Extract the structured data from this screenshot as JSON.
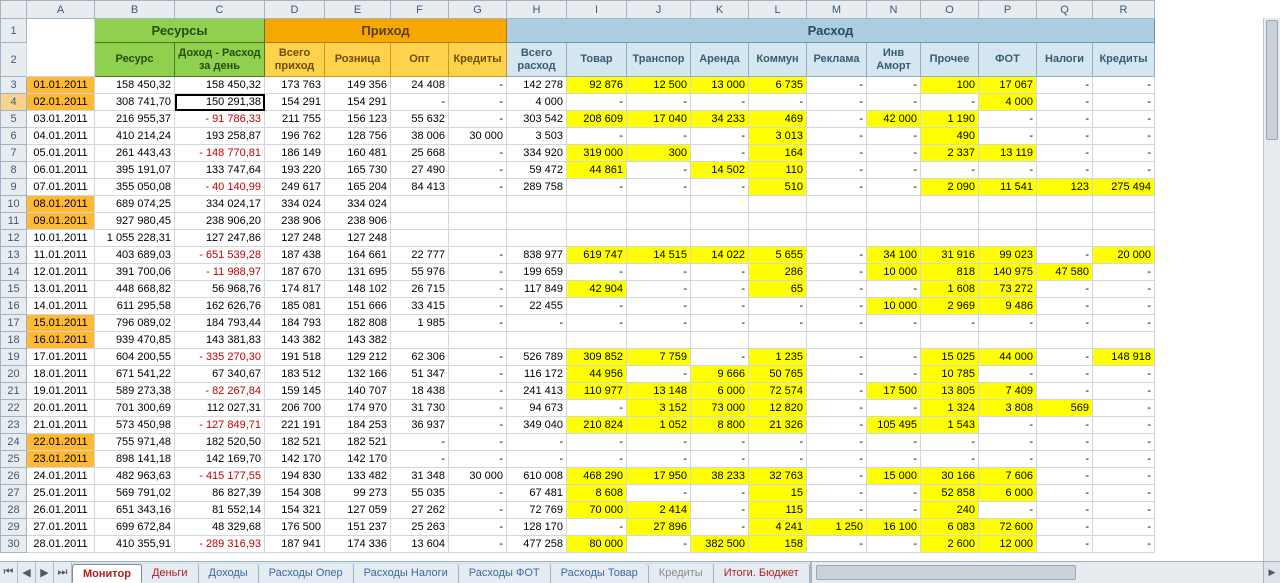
{
  "colLetters": [
    "A",
    "B",
    "C",
    "D",
    "E",
    "F",
    "G",
    "H",
    "I",
    "J",
    "K",
    "L",
    "M",
    "N",
    "O",
    "P",
    "Q",
    "R"
  ],
  "groups": {
    "res": "Ресурсы",
    "inc": "Приход",
    "exp": "Расход"
  },
  "sub": {
    "B": "Ресурс",
    "C": "Доход - Расход за день",
    "D": "Всего приход",
    "E": "Розница",
    "F": "Опт",
    "G": "Кредиты",
    "H": "Всего расход",
    "I": "Товар",
    "J": "Транспор",
    "K": "Аренда",
    "L": "Коммун",
    "M": "Реклама",
    "N": "Инв Аморт",
    "O": "Прочее",
    "P": "ФОТ",
    "Q": "Налоги",
    "R": "Кредиты"
  },
  "selectedCell": {
    "row": 4,
    "col": "C"
  },
  "rows": [
    {
      "n": 3,
      "A": "01.01.2011",
      "dOrange": true,
      "B": "158 450,32",
      "C": "158 450,32",
      "D": "173 763",
      "E": "149 356",
      "F": "24 408",
      "G": "-",
      "H": "142 278",
      "I": "92 876",
      "Iy": true,
      "J": "12 500",
      "Jy": true,
      "K": "13 000",
      "Ky": true,
      "L": "6 735",
      "Ly": true,
      "M": "-",
      "N": "-",
      "O": "100",
      "Oy": true,
      "P": "17 067",
      "Py": true,
      "Q": "-",
      "R": "-"
    },
    {
      "n": 4,
      "A": "02.01.2011",
      "dOrange": true,
      "B": "308 741,70",
      "C": "150 291,38",
      "D": "154 291",
      "E": "154 291",
      "F": "-",
      "G": "-",
      "H": "4 000",
      "I": "-",
      "J": "-",
      "K": "-",
      "L": "-",
      "M": "-",
      "N": "-",
      "O": "-",
      "P": "4 000",
      "Py": true,
      "Q": "-",
      "R": "-"
    },
    {
      "n": 5,
      "A": "03.01.2011",
      "B": "216 955,37",
      "C": "91 786,33",
      "Cred": true,
      "D": "211 755",
      "E": "156 123",
      "F": "55 632",
      "G": "-",
      "H": "303 542",
      "I": "208 609",
      "Iy": true,
      "J": "17 040",
      "Jy": true,
      "K": "34 233",
      "Ky": true,
      "L": "469",
      "Ly": true,
      "M": "-",
      "N": "42 000",
      "Ny": true,
      "O": "1 190",
      "Oy": true,
      "P": "-",
      "Q": "-",
      "R": "-"
    },
    {
      "n": 6,
      "A": "04.01.2011",
      "B": "410 214,24",
      "C": "193 258,87",
      "D": "196 762",
      "E": "128 756",
      "F": "38 006",
      "G": "30 000",
      "H": "3 503",
      "I": "-",
      "J": "-",
      "K": "-",
      "L": "3 013",
      "Ly": true,
      "M": "-",
      "N": "-",
      "O": "490",
      "Oy": true,
      "P": "-",
      "Q": "-",
      "R": "-"
    },
    {
      "n": 7,
      "A": "05.01.2011",
      "B": "261 443,43",
      "C": "148 770,81",
      "Cred": true,
      "D": "186 149",
      "E": "160 481",
      "F": "25 668",
      "G": "-",
      "H": "334 920",
      "I": "319 000",
      "Iy": true,
      "J": "300",
      "Jy": true,
      "K": "-",
      "L": "164",
      "Ly": true,
      "M": "-",
      "N": "-",
      "O": "2 337",
      "Oy": true,
      "P": "13 119",
      "Py": true,
      "Q": "-",
      "R": "-"
    },
    {
      "n": 8,
      "A": "06.01.2011",
      "B": "395 191,07",
      "C": "133 747,64",
      "D": "193 220",
      "E": "165 730",
      "F": "27 490",
      "G": "-",
      "H": "59 472",
      "I": "44 861",
      "Iy": true,
      "J": "-",
      "K": "14 502",
      "Ky": true,
      "L": "110",
      "Ly": true,
      "M": "-",
      "N": "-",
      "O": "-",
      "P": "-",
      "Q": "-",
      "R": "-"
    },
    {
      "n": 9,
      "A": "07.01.2011",
      "B": "355 050,08",
      "C": "40 140,99",
      "Cred": true,
      "D": "249 617",
      "E": "165 204",
      "F": "84 413",
      "G": "-",
      "H": "289 758",
      "I": "-",
      "J": "-",
      "K": "-",
      "L": "510",
      "Ly": true,
      "M": "-",
      "N": "-",
      "O": "2 090",
      "Oy": true,
      "P": "11 541",
      "Py": true,
      "Q": "123",
      "Qy": true,
      "R": "275 494",
      "Ry": true
    },
    {
      "n": 10,
      "A": "08.01.2011",
      "dOrange": true,
      "B": "689 074,25",
      "C": "334 024,17",
      "D": "334 024",
      "E": "334 024",
      "F": "",
      "G": "",
      "H": "",
      "I": "",
      "J": "",
      "K": "",
      "L": "",
      "M": "",
      "N": "",
      "O": "",
      "P": "",
      "Q": "",
      "R": ""
    },
    {
      "n": 11,
      "A": "09.01.2011",
      "dOrange": true,
      "B": "927 980,45",
      "C": "238 906,20",
      "D": "238 906",
      "E": "238 906",
      "F": "",
      "G": "",
      "H": "",
      "I": "",
      "J": "",
      "K": "",
      "L": "",
      "M": "",
      "N": "",
      "O": "",
      "P": "",
      "Q": "",
      "R": ""
    },
    {
      "n": 12,
      "A": "10.01.2011",
      "B": "1 055 228,31",
      "C": "127 247,86",
      "D": "127 248",
      "E": "127 248",
      "F": "",
      "G": "",
      "H": "",
      "I": "",
      "J": "",
      "K": "",
      "L": "",
      "M": "",
      "N": "",
      "O": "",
      "P": "",
      "Q": "",
      "R": ""
    },
    {
      "n": 13,
      "A": "11.01.2011",
      "B": "403 689,03",
      "C": "651 539,28",
      "Cred": true,
      "D": "187 438",
      "E": "164 661",
      "F": "22 777",
      "G": "-",
      "H": "838 977",
      "I": "619 747",
      "Iy": true,
      "J": "14 515",
      "Jy": true,
      "K": "14 022",
      "Ky": true,
      "L": "5 655",
      "Ly": true,
      "M": "-",
      "N": "34 100",
      "Ny": true,
      "O": "31 916",
      "Oy": true,
      "P": "99 023",
      "Py": true,
      "Q": "-",
      "R": "20 000",
      "Ry": true
    },
    {
      "n": 14,
      "A": "12.01.2011",
      "B": "391 700,06",
      "C": "11 988,97",
      "Cred": true,
      "D": "187 670",
      "E": "131 695",
      "F": "55 976",
      "G": "-",
      "H": "199 659",
      "I": "-",
      "J": "-",
      "K": "-",
      "L": "286",
      "Ly": true,
      "M": "-",
      "N": "10 000",
      "Ny": true,
      "O": "818",
      "Oy": true,
      "P": "140 975",
      "Py": true,
      "Q": "47 580",
      "Qy": true,
      "R": "-"
    },
    {
      "n": 15,
      "A": "13.01.2011",
      "B": "448 668,82",
      "C": "56 968,76",
      "D": "174 817",
      "E": "148 102",
      "F": "26 715",
      "G": "-",
      "H": "117 849",
      "I": "42 904",
      "Iy": true,
      "J": "-",
      "K": "-",
      "L": "65",
      "Ly": true,
      "M": "-",
      "N": "-",
      "O": "1 608",
      "Oy": true,
      "P": "73 272",
      "Py": true,
      "Q": "-",
      "R": "-"
    },
    {
      "n": 16,
      "A": "14.01.2011",
      "B": "611 295,58",
      "C": "162 626,76",
      "D": "185 081",
      "E": "151 666",
      "F": "33 415",
      "G": "-",
      "H": "22 455",
      "I": "-",
      "J": "-",
      "K": "-",
      "L": "-",
      "M": "-",
      "N": "10 000",
      "Ny": true,
      "O": "2 969",
      "Oy": true,
      "P": "9 486",
      "Py": true,
      "Q": "-",
      "R": "-"
    },
    {
      "n": 17,
      "A": "15.01.2011",
      "dOrange": true,
      "B": "796 089,02",
      "C": "184 793,44",
      "D": "184 793",
      "E": "182 808",
      "F": "1 985",
      "G": "-",
      "H": "-",
      "I": "-",
      "J": "-",
      "K": "-",
      "L": "-",
      "M": "-",
      "N": "-",
      "O": "-",
      "P": "-",
      "Q": "-",
      "R": "-"
    },
    {
      "n": 18,
      "A": "16.01.2011",
      "dOrange": true,
      "B": "939 470,85",
      "C": "143 381,83",
      "D": "143 382",
      "E": "143 382",
      "F": "",
      "G": "",
      "H": "",
      "I": "",
      "J": "",
      "K": "",
      "L": "",
      "M": "",
      "N": "",
      "O": "",
      "P": "",
      "Q": "",
      "R": ""
    },
    {
      "n": 19,
      "A": "17.01.2011",
      "B": "604 200,55",
      "C": "335 270,30",
      "Cred": true,
      "D": "191 518",
      "E": "129 212",
      "F": "62 306",
      "G": "-",
      "H": "526 789",
      "I": "309 852",
      "Iy": true,
      "J": "7 759",
      "Jy": true,
      "K": "-",
      "L": "1 235",
      "Ly": true,
      "M": "-",
      "N": "-",
      "O": "15 025",
      "Oy": true,
      "P": "44 000",
      "Py": true,
      "Q": "-",
      "R": "148 918",
      "Ry": true
    },
    {
      "n": 20,
      "A": "18.01.2011",
      "B": "671 541,22",
      "C": "67 340,67",
      "D": "183 512",
      "E": "132 166",
      "F": "51 347",
      "G": "-",
      "H": "116 172",
      "I": "44 956",
      "Iy": true,
      "J": "-",
      "K": "9 666",
      "Ky": true,
      "L": "50 765",
      "Ly": true,
      "M": "-",
      "N": "-",
      "O": "10 785",
      "Oy": true,
      "P": "-",
      "Q": "-",
      "R": "-"
    },
    {
      "n": 21,
      "A": "19.01.2011",
      "B": "589 273,38",
      "C": "82 267,84",
      "Cred": true,
      "D": "159 145",
      "E": "140 707",
      "F": "18 438",
      "G": "-",
      "H": "241 413",
      "I": "110 977",
      "Iy": true,
      "J": "13 148",
      "Jy": true,
      "K": "6 000",
      "Ky": true,
      "L": "72 574",
      "Ly": true,
      "M": "-",
      "N": "17 500",
      "Ny": true,
      "O": "13 805",
      "Oy": true,
      "P": "7 409",
      "Py": true,
      "Q": "-",
      "R": "-"
    },
    {
      "n": 22,
      "A": "20.01.2011",
      "B": "701 300,69",
      "C": "112 027,31",
      "D": "206 700",
      "E": "174 970",
      "F": "31 730",
      "G": "-",
      "H": "94 673",
      "I": "-",
      "J": "3 152",
      "Jy": true,
      "K": "73 000",
      "Ky": true,
      "L": "12 820",
      "Ly": true,
      "M": "-",
      "N": "-",
      "O": "1 324",
      "Oy": true,
      "P": "3 808",
      "Py": true,
      "Q": "569",
      "Qy": true,
      "R": "-"
    },
    {
      "n": 23,
      "A": "21.01.2011",
      "B": "573 450,98",
      "C": "127 849,71",
      "Cred": true,
      "D": "221 191",
      "E": "184 253",
      "F": "36 937",
      "G": "-",
      "H": "349 040",
      "I": "210 824",
      "Iy": true,
      "J": "1 052",
      "Jy": true,
      "K": "8 800",
      "Ky": true,
      "L": "21 326",
      "Ly": true,
      "M": "-",
      "N": "105 495",
      "Ny": true,
      "O": "1 543",
      "Oy": true,
      "P": "-",
      "Q": "-",
      "R": "-"
    },
    {
      "n": 24,
      "A": "22.01.2011",
      "dOrange": true,
      "B": "755 971,48",
      "C": "182 520,50",
      "D": "182 521",
      "E": "182 521",
      "F": "-",
      "G": "-",
      "H": "-",
      "I": "-",
      "J": "-",
      "K": "-",
      "L": "-",
      "M": "-",
      "N": "-",
      "O": "-",
      "P": "-",
      "Q": "-",
      "R": "-"
    },
    {
      "n": 25,
      "A": "23.01.2011",
      "dOrange": true,
      "B": "898 141,18",
      "C": "142 169,70",
      "D": "142 170",
      "E": "142 170",
      "F": "-",
      "G": "-",
      "H": "-",
      "I": "-",
      "J": "-",
      "K": "-",
      "L": "-",
      "M": "-",
      "N": "-",
      "O": "-",
      "P": "-",
      "Q": "-",
      "R": "-"
    },
    {
      "n": 26,
      "A": "24.01.2011",
      "B": "482 963,63",
      "C": "415 177,55",
      "Cred": true,
      "D": "194 830",
      "E": "133 482",
      "F": "31 348",
      "G": "30 000",
      "H": "610 008",
      "I": "468 290",
      "Iy": true,
      "J": "17 950",
      "Jy": true,
      "K": "38 233",
      "Ky": true,
      "L": "32 763",
      "Ly": true,
      "M": "-",
      "N": "15 000",
      "Ny": true,
      "O": "30 166",
      "Oy": true,
      "P": "7 606",
      "Py": true,
      "Q": "-",
      "R": "-"
    },
    {
      "n": 27,
      "A": "25.01.2011",
      "B": "569 791,02",
      "C": "86 827,39",
      "D": "154 308",
      "E": "99 273",
      "F": "55 035",
      "G": "-",
      "H": "67 481",
      "I": "8 608",
      "Iy": true,
      "J": "-",
      "K": "-",
      "L": "15",
      "Ly": true,
      "M": "-",
      "N": "-",
      "O": "52 858",
      "Oy": true,
      "P": "6 000",
      "Py": true,
      "Q": "-",
      "R": "-"
    },
    {
      "n": 28,
      "A": "26.01.2011",
      "B": "651 343,16",
      "C": "81 552,14",
      "D": "154 321",
      "E": "127 059",
      "F": "27 262",
      "G": "-",
      "H": "72 769",
      "I": "70 000",
      "Iy": true,
      "J": "2 414",
      "Jy": true,
      "K": "-",
      "L": "115",
      "Ly": true,
      "M": "-",
      "N": "-",
      "O": "240",
      "Oy": true,
      "P": "-",
      "Q": "-",
      "R": "-"
    },
    {
      "n": 29,
      "A": "27.01.2011",
      "B": "699 672,84",
      "C": "48 329,68",
      "D": "176 500",
      "E": "151 237",
      "F": "25 263",
      "G": "-",
      "H": "128 170",
      "I": "-",
      "J": "27 896",
      "Jy": true,
      "K": "-",
      "L": "4 241",
      "Ly": true,
      "M": "1 250",
      "My": true,
      "N": "16 100",
      "Ny": true,
      "O": "6 083",
      "Oy": true,
      "P": "72 600",
      "Py": true,
      "Q": "-",
      "R": "-"
    },
    {
      "n": 30,
      "A": "28.01.2011",
      "B": "410 355,91",
      "C": "289 316,93",
      "Cred": true,
      "D": "187 941",
      "E": "174 336",
      "F": "13 604",
      "G": "-",
      "H": "477 258",
      "I": "80 000",
      "Iy": true,
      "J": "-",
      "K": "382 500",
      "Ky": true,
      "L": "158",
      "Ly": true,
      "M": "-",
      "N": "-",
      "O": "2 600",
      "Oy": true,
      "P": "12 000",
      "Py": true,
      "Q": "-",
      "R": "-"
    }
  ],
  "colWidths": {
    "_hdr": 26,
    "A": 68,
    "B": 80,
    "C": 90,
    "D": 60,
    "E": 66,
    "F": 58,
    "G": 58,
    "H": 60,
    "I": 60,
    "J": 64,
    "K": 58,
    "L": 58,
    "M": 60,
    "N": 54,
    "O": 58,
    "P": 58,
    "Q": 56,
    "R": 62
  },
  "tabs": [
    {
      "label": "Монитор",
      "cls": "active red"
    },
    {
      "label": "Деньги",
      "cls": "red"
    },
    {
      "label": "Доходы",
      "cls": "blue"
    },
    {
      "label": "Расходы Опер",
      "cls": "blue"
    },
    {
      "label": "Расходы Налоги",
      "cls": "blue"
    },
    {
      "label": "Расходы ФОТ",
      "cls": "blue"
    },
    {
      "label": "Расходы Товар",
      "cls": "blue"
    },
    {
      "label": "Кредиты",
      "cls": "gray"
    },
    {
      "label": "Итоги. Бюджет",
      "cls": "red"
    }
  ],
  "navGlyphs": {
    "first": "⏮",
    "prev": "◀",
    "next": "▶",
    "last": "⏭"
  }
}
